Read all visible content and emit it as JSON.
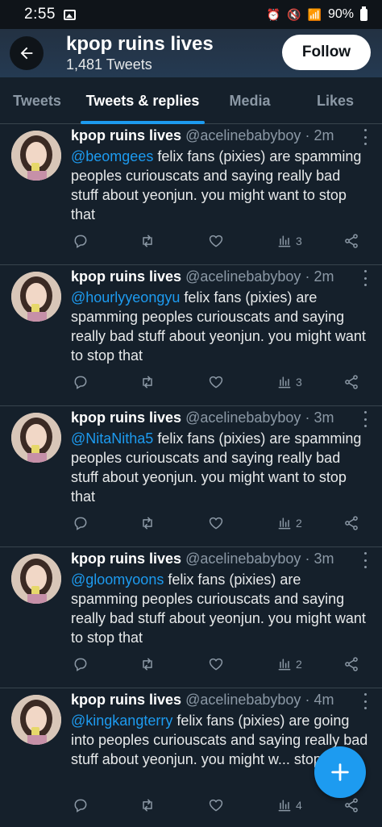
{
  "status_bar": {
    "time": "2:55",
    "battery": "90%"
  },
  "header": {
    "title": "kpop ruins lives",
    "subtitle": "1,481 Tweets",
    "follow_label": "Follow"
  },
  "tabs": [
    {
      "label": "Tweets"
    },
    {
      "label": "Tweets & replies"
    },
    {
      "label": "Media"
    },
    {
      "label": "Likes"
    }
  ],
  "tweets": [
    {
      "name": "kpop ruins lives",
      "handle": "@acelinebabyboy",
      "time": "· 2m",
      "mention": "@beomgees",
      "text": " felix fans (pixies) are spamming peoples curiouscats and saying really bad stuff about yeonjun. you might want to stop that",
      "views": "3"
    },
    {
      "name": "kpop ruins lives",
      "handle": "@acelinebabyboy",
      "time": "· 2m",
      "mention": "@hourlyyeongyu",
      "text": " felix fans (pixies) are spamming peoples curiouscats and saying really bad stuff about yeonjun. you might want to stop that",
      "views": "3"
    },
    {
      "name": "kpop ruins lives",
      "handle": "@acelinebabyboy",
      "time": "· 3m",
      "mention": "@NitaNitha5",
      "text": " felix fans (pixies) are spamming peoples curiouscats and saying really bad stuff about yeonjun. you might want to stop that",
      "views": "2"
    },
    {
      "name": "kpop ruins lives",
      "handle": "@acelinebabyboy",
      "time": "· 3m",
      "mention": "@gloomyoons",
      "text": " felix fans (pixies) are spamming peoples curiouscats and saying really bad stuff about yeonjun. you might want to stop that",
      "views": "2"
    },
    {
      "name": "kpop ruins lives",
      "handle": "@acelinebabyboy",
      "time": "· 4m",
      "mention": "@kingkangterry",
      "text": " felix fans (pixies) are going into peoples curiouscats and saying really bad stuff about yeonjun. you might w... stop that",
      "views": "4"
    }
  ],
  "icons": {
    "back": "arrow-left-icon",
    "reply": "reply-icon",
    "retweet": "retweet-icon",
    "like": "heart-icon",
    "views": "views-icon",
    "share": "share-icon",
    "compose": "plus-icon"
  },
  "colors": {
    "background": "#15202b",
    "accent": "#1d9bf0",
    "muted": "#8b98a5"
  }
}
